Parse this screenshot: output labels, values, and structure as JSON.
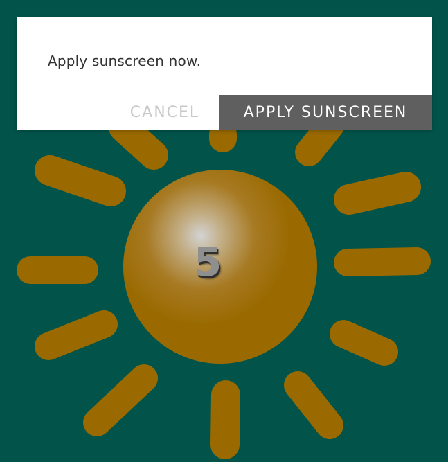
{
  "colors": {
    "background": "#02544B",
    "sun": "#9A6A00",
    "sun_highlight": "#D3D3D3",
    "apply_button": "#5F5F5F",
    "cancel_text": "#C9C9C9"
  },
  "sun": {
    "icon": "sun-icon",
    "uv_index": "5"
  },
  "dialog": {
    "message": "Apply sunscreen now.",
    "cancel_label": "CANCEL",
    "apply_label": "APPLY SUNSCREEN"
  }
}
